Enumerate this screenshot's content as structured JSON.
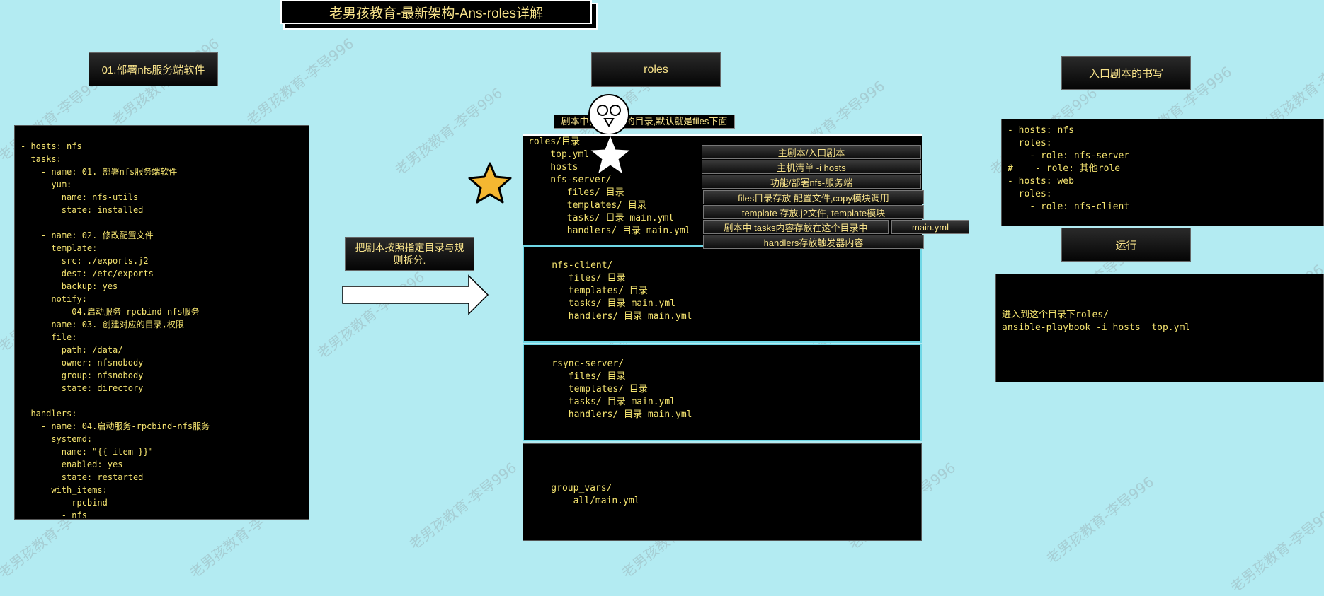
{
  "title": "老男孩教育-最新架构-Ans-roles详解",
  "watermark": "老男孩教育-李导996",
  "left_header": "01.部署nfs服务端软件",
  "left_code": [
    "---",
    "- hosts: nfs",
    "  tasks:",
    "    - name: 01. 部署nfs服务端软件",
    "      yum:",
    "        name: nfs-utils",
    "        state: installed",
    "",
    "    - name: 02. 修改配置文件",
    "      template:",
    "        src: ./exports.j2",
    "        dest: /etc/exports",
    "        backup: yes",
    "      notify:",
    "        - 04.启动服务-rpcbind-nfs服务",
    "    - name: 03. 创建对应的目录,权限",
    "      file:",
    "        path: /data/",
    "        owner: nfsnobody",
    "        group: nfsnobody",
    "        state: directory",
    "",
    "  handlers:",
    "    - name: 04.启动服务-rpcbind-nfs服务",
    "      systemd:",
    "        name: \"{{ item }}\"",
    "        enabled: yes",
    "        state: restarted",
    "      with_items:",
    "        - rpcbind",
    "        - nfs"
  ],
  "arrow_label": "把剧本按照指定目录与规则拆分.",
  "roles_header": "roles",
  "files_note": "剧本中使用文件的目录,默认就是files下面",
  "roles_block1": [
    "roles/目录",
    "    top.yml",
    "    hosts",
    "    nfs-server/",
    "       files/ 目录",
    "       templates/ 目录",
    "       tasks/ 目录 main.yml",
    "       handlers/ 目录 main.yml"
  ],
  "roles_block2": [
    "",
    "    nfs-client/",
    "       files/ 目录",
    "       templates/ 目录",
    "       tasks/ 目录 main.yml",
    "       handlers/ 目录 main.yml"
  ],
  "roles_block3": [
    "",
    "    rsync-server/",
    "       files/ 目录",
    "       templates/ 目录",
    "       tasks/ 目录 main.yml",
    "       handlers/ 目录 main.yml"
  ],
  "roles_block4": [
    "",
    "",
    "",
    "    group_vars/",
    "        all/main.yml"
  ],
  "annotations": [
    "主剧本/入口剧本",
    "主机清单  -i hosts",
    "功能/部署nfs-服务端",
    "files目录存放 配置文件,copy模块调用",
    "template  存放.j2文件, template模块",
    "剧本中 tasks内容存放在这个目录中",
    "handlers存放触发器内容"
  ],
  "main_yml_tag": "main.yml",
  "entry_header": "入口剧本的书写",
  "entry_code": [
    "- hosts: nfs",
    "  roles:",
    "    - role: nfs-server",
    "#    - role: 其他role",
    "- hosts: web",
    "  roles:",
    "    - role: nfs-client"
  ],
  "run_header": "运行",
  "run_code": [
    "",
    "",
    "进入到这个目录下roles/",
    "ansible-playbook -i hosts  top.yml"
  ],
  "colors": {
    "background": "#b3ebf2",
    "code_text": "#f4e36f",
    "accent_border": "#6fd7e6",
    "star_gold": "#f5b731"
  },
  "icons": [
    "star-icon",
    "white-star-icon",
    "owl-avatar-icon",
    "right-arrow-icon"
  ]
}
